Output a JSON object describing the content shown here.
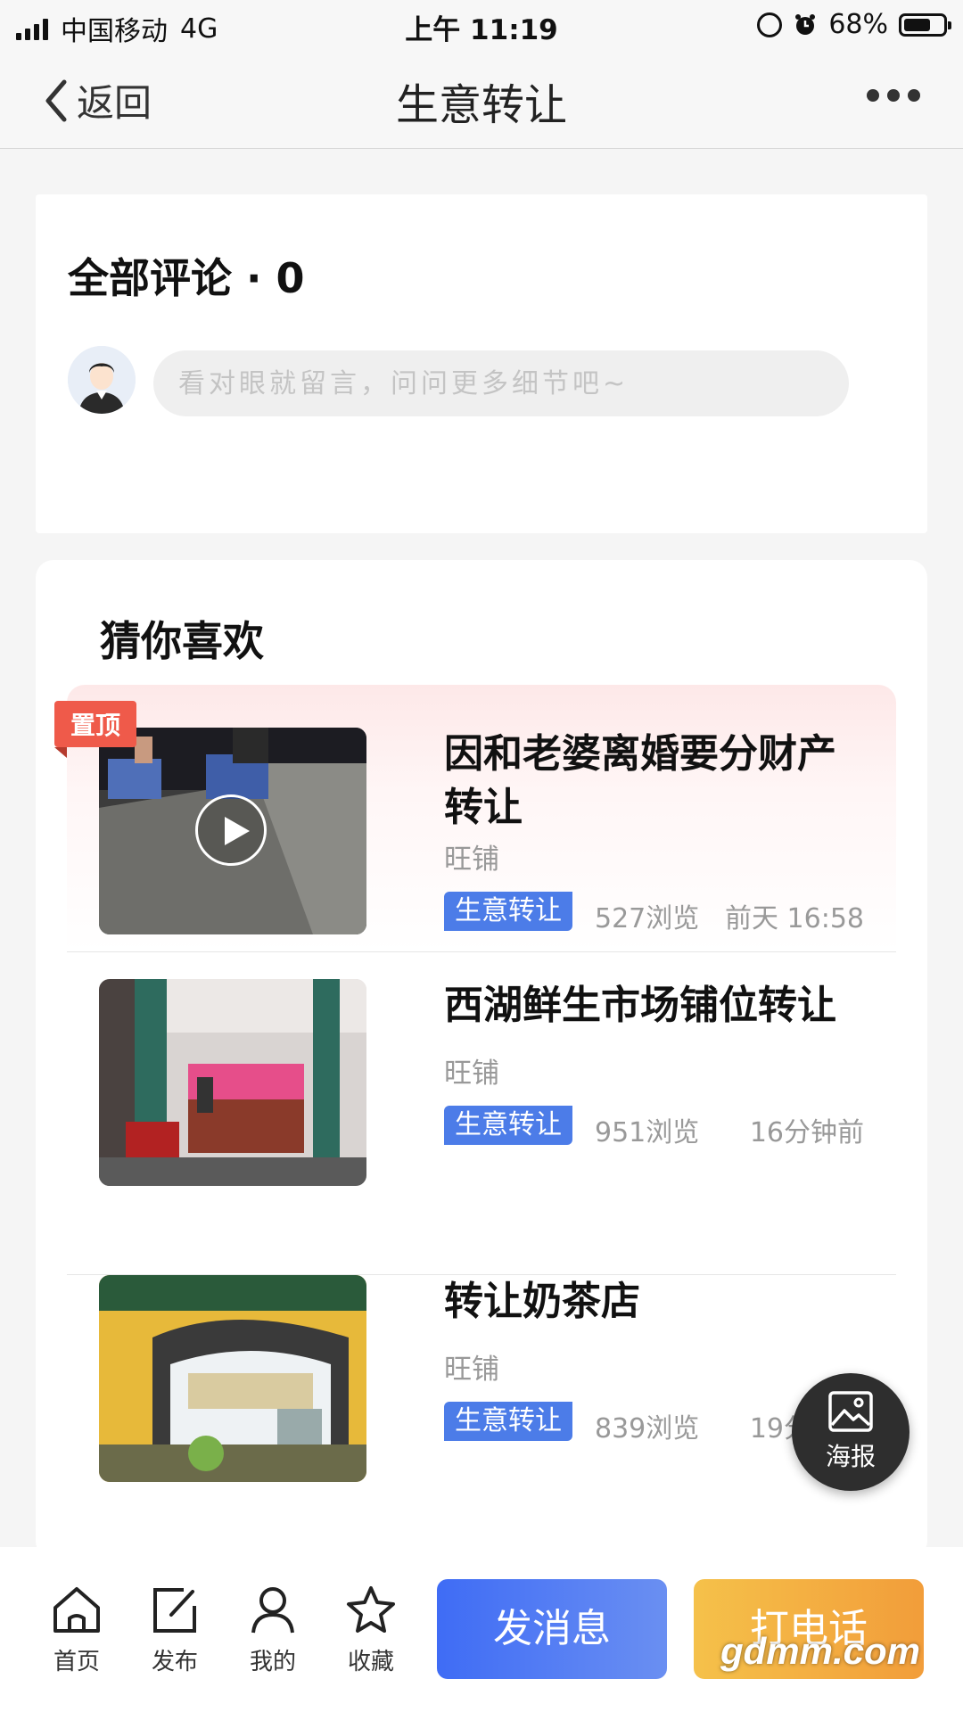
{
  "status_bar": {
    "carrier": "中国移动",
    "network": "4G",
    "time": "上午 11:19",
    "battery": "68%",
    "battery_level": 0.68
  },
  "nav": {
    "back_label": "返回",
    "title": "生意转让",
    "more_icon": "more-dots-icon"
  },
  "comments": {
    "title": "全部评论 · 0",
    "input_placeholder": "看对眼就留言，问问更多细节吧~"
  },
  "recommend": {
    "title": "猜你喜欢",
    "items": [
      {
        "pinned_label": "置顶",
        "title": "因和老婆离婚要分财产转让",
        "source": "旺铺",
        "tag": "生意转让",
        "views": "527浏览",
        "time": "前天 16:58",
        "has_video": true
      },
      {
        "title": "西湖鲜生市场铺位转让",
        "source": "旺铺",
        "tag": "生意转让",
        "views": "951浏览",
        "time": "16分钟前"
      },
      {
        "title": "转让奶茶店",
        "source": "旺铺",
        "tag": "生意转让",
        "views": "839浏览",
        "time": "19分钟前"
      }
    ]
  },
  "poster_button": {
    "label": "海报",
    "icon": "image-icon"
  },
  "bottom_bar": {
    "tabs": [
      {
        "label": "首页",
        "icon": "home-icon"
      },
      {
        "label": "发布",
        "icon": "edit-icon"
      },
      {
        "label": "我的",
        "icon": "user-icon"
      },
      {
        "label": "收藏",
        "icon": "star-icon"
      }
    ],
    "message_button": "发消息",
    "call_button": "打电话"
  },
  "watermark": "gdmm.com",
  "colors": {
    "accent_blue": "#4c7ce8",
    "call_orange": "#f29d3a",
    "pinned_red": "#ef5a4a"
  }
}
